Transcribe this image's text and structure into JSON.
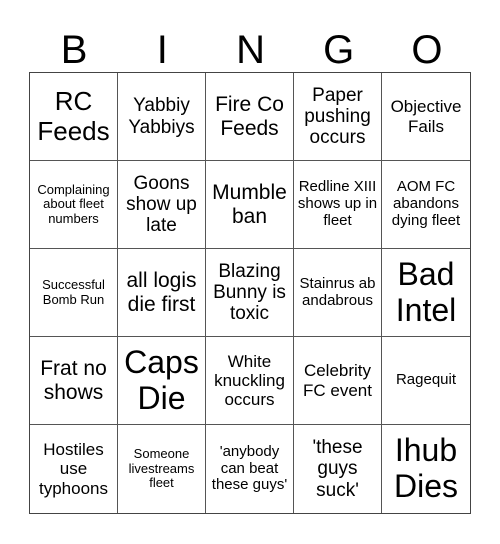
{
  "header": [
    "B",
    "I",
    "N",
    "G",
    "O"
  ],
  "cells": [
    "RC Feeds",
    "Yabbiy Yabbiys",
    "Fire Co Feeds",
    "Paper pushing occurs",
    "Objective Fails",
    "Complaining about fleet numbers",
    "Goons show up late",
    "Mumble ban",
    "Redline XIII shows up in fleet",
    "AOM FC abandons dying fleet",
    "Successful Bomb Run",
    "all logis die first",
    "Blazing Bunny is toxic",
    "Stainrus abandabrous",
    "Bad Intel",
    "Frat no shows",
    "Caps Die",
    "White knuckling occurs",
    "Celebrity FC event",
    "Ragequit",
    "Hostiles use typhoons",
    "Someone livestreams fleet",
    "'anybody can beat these guys'",
    "'these guys suck'",
    "Ihub Dies"
  ]
}
